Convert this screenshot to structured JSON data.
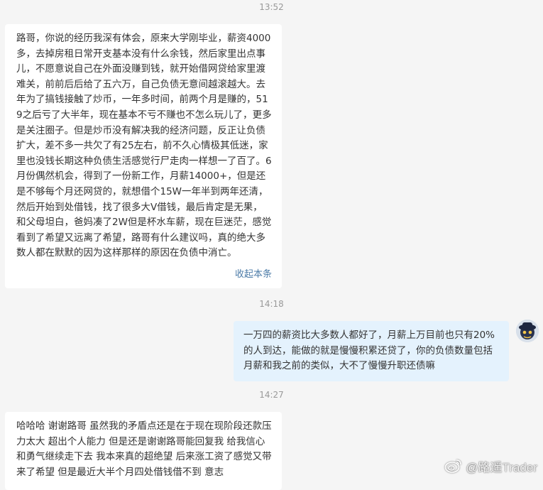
{
  "timestamps": {
    "t1": "13:52",
    "t2": "14:18",
    "t3": "14:27"
  },
  "messages": [
    {
      "sender": "other",
      "text": "路哥，你说的经历我深有体会，原来大学刚毕业，薪资4000多，去掉房租日常开支基本没有什么余钱，然后家里出点事儿，不愿意说自己在外面没赚到钱，就开始借网贷给家里渡难关，前前后后给了五六万，自己负债无意间越滚越大。去年为了搞钱接触了炒币，一年多时间，前两个月是赚的，519之后亏了大半年，现在基本不亏不赚也不怎么玩儿了，更多是关注圈子。但是炒币没有解决我的经济问题，反正让负债扩大，差不多一共欠了有25左右，前不久心情极其低迷，家里也没钱长期这种负债生活感觉行尸走肉一样想一了百了。6月份偶然机会，得到了一份新工作，月薪14000+，但是还是不够每个月还网贷的，就想借个15W一年半到两年还清，然后开始到处借钱，找了很多大V借钱，最后肯定是无果，和父母坦白，爸妈凑了2W但是杯水车薪，现在巨迷茫，感觉看到了希望又远离了希望，路哥有什么建议吗，真的绝大多数人都在默默的因为这样那样的原因在负债中消亡。",
      "collapse_label": "收起本条"
    },
    {
      "sender": "me",
      "text": "一万四的薪资比大多数人都好了，月薪上万目前也只有20%的人到达，能做的就是慢慢积累还贷了，你的负债数量包括月薪和我之前的类似，大不了慢慢升职还债嘛"
    },
    {
      "sender": "other",
      "text": "哈哈哈 谢谢路哥 虽然我的矛盾点还是在于现在现阶段还款压力太大 超出个人能力 但是还是谢谢路哥能回复我 给我信心和勇气继续走下去 我本来真的超绝望 后来涨工资了感觉又带来了希望 但是最近大半个月四处借钱借不到 意志"
    }
  ],
  "watermark": {
    "text": "@路遥Trader",
    "icon": "weibo-logo-icon"
  },
  "avatar": {
    "icon": "user-avatar-icon"
  }
}
